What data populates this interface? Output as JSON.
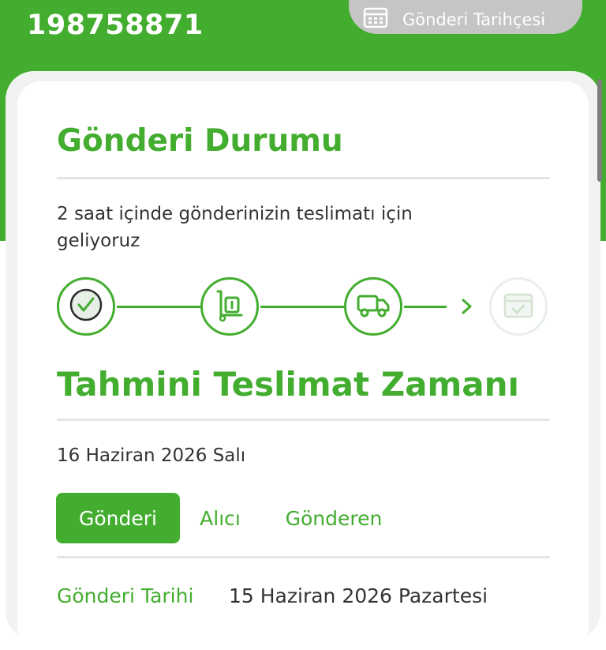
{
  "header": {
    "tracking_number": "198758871",
    "history_button_label": "Gönderi Tarihçesi"
  },
  "status": {
    "title": "Gönderi Durumu",
    "message": "2 saat içinde gönderinizin teslimatı için geliyoruz",
    "steps": [
      {
        "icon": "check-circle-icon",
        "state": "done"
      },
      {
        "icon": "hand-truck-icon",
        "state": "done"
      },
      {
        "icon": "delivery-truck-icon",
        "state": "done"
      },
      {
        "icon": "package-check-icon",
        "state": "pending"
      }
    ]
  },
  "eta": {
    "title": "Tahmini Teslimat Zamanı",
    "date": "16 Haziran 2026 Salı"
  },
  "tabs": [
    {
      "label": "Gönderi",
      "active": true
    },
    {
      "label": "Alıcı",
      "active": false
    },
    {
      "label": "Gönderen",
      "active": false
    }
  ],
  "details": {
    "shipment_date_label": "Gönderi Tarihi",
    "shipment_date_value": "15 Haziran 2026 Pazartesi"
  },
  "colors": {
    "brand_green": "#43ad2f",
    "button_gray": "#c5c5c5",
    "faded_step": "#e8efe7"
  }
}
